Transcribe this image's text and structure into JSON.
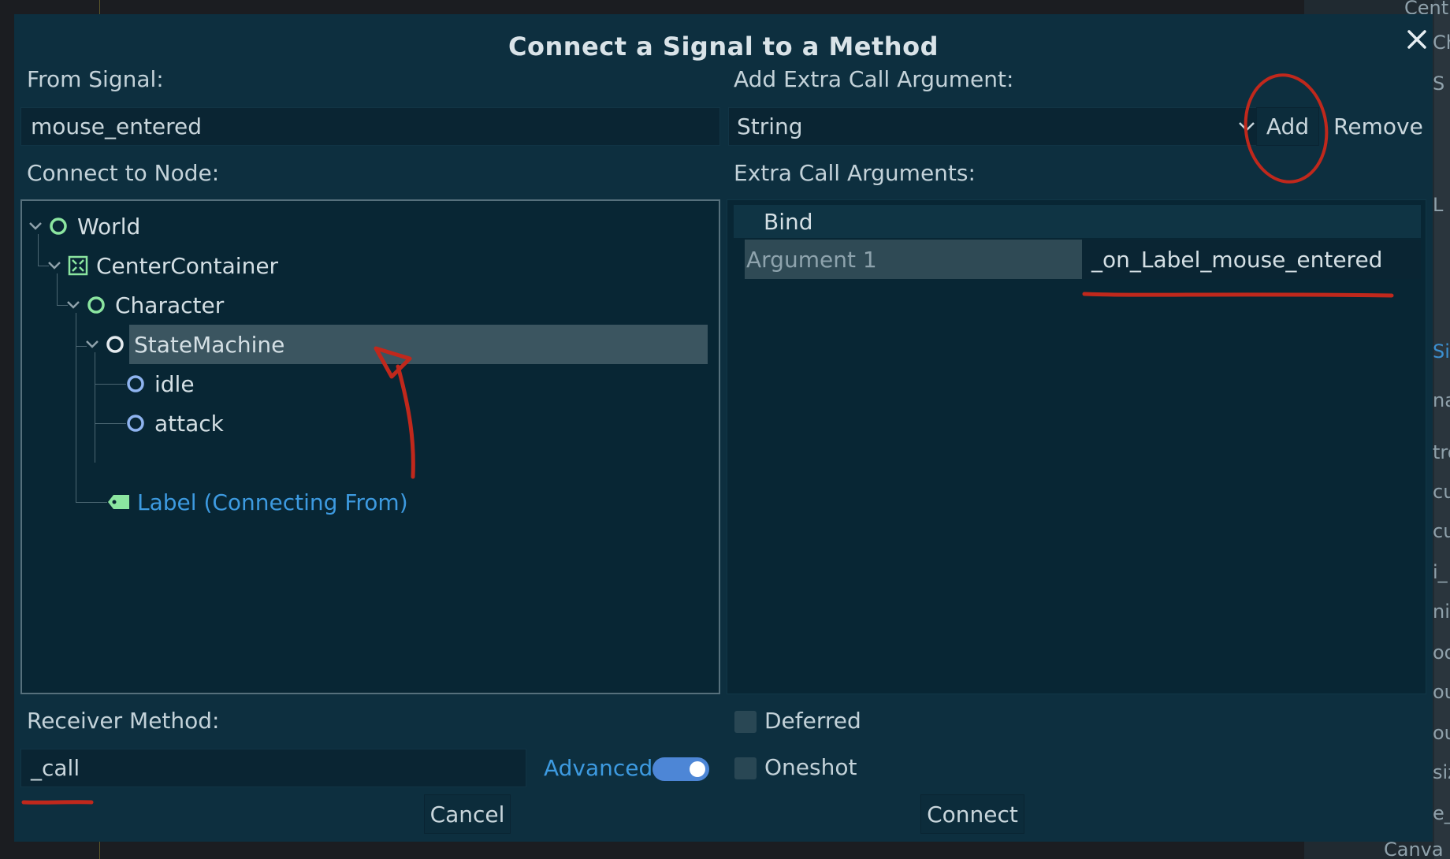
{
  "background": {
    "fragments": [
      "Cent",
      "Ch",
      "S",
      "L",
      "Si",
      "na",
      "tro",
      "cu",
      "cu",
      "i_",
      "ni",
      "od",
      "ou",
      "ou",
      "siz",
      "e_",
      "Canva"
    ]
  },
  "dialog": {
    "title": "Connect a Signal to a Method",
    "close_icon": "close-icon",
    "from_signal": {
      "label": "From Signal:",
      "value": "mouse_entered"
    },
    "extra_arg": {
      "label": "Add Extra Call Argument:",
      "type_value": "String",
      "add_label": "Add",
      "remove_label": "Remove"
    },
    "connect_to_node": {
      "label": "Connect to Node:"
    },
    "tree": {
      "items": [
        {
          "label": "World",
          "icon": "node-circle-icon"
        },
        {
          "label": "CenterContainer",
          "icon": "center-container-icon"
        },
        {
          "label": "Character",
          "icon": "node-circle-icon"
        },
        {
          "label": "StateMachine",
          "icon": "node-circle-icon"
        },
        {
          "label": "idle",
          "icon": "node-circle-blue-icon"
        },
        {
          "label": "attack",
          "icon": "node-circle-blue-icon"
        },
        {
          "label": "Label (Connecting From)",
          "icon": "label-tag-icon"
        }
      ]
    },
    "extra_call_arguments": {
      "label": "Extra Call Arguments:",
      "header": "Bind",
      "rows": [
        {
          "key": "Argument 1",
          "value": "_on_Label_mouse_entered"
        }
      ]
    },
    "receiver_method": {
      "label": "Receiver Method:",
      "value": "_call"
    },
    "advanced": {
      "label": "Advanced",
      "enabled": true
    },
    "deferred": {
      "label": "Deferred",
      "checked": false
    },
    "oneshot": {
      "label": "Oneshot",
      "checked": false
    },
    "cancel_label": "Cancel",
    "connect_label": "Connect",
    "colors": {
      "dialog_bg": "#0d2f3f",
      "accent_blue": "#3d9ae0",
      "node_green": "#8be5a0",
      "node_blue": "#8fb4f0",
      "annotation_red": "#c0281c"
    }
  }
}
